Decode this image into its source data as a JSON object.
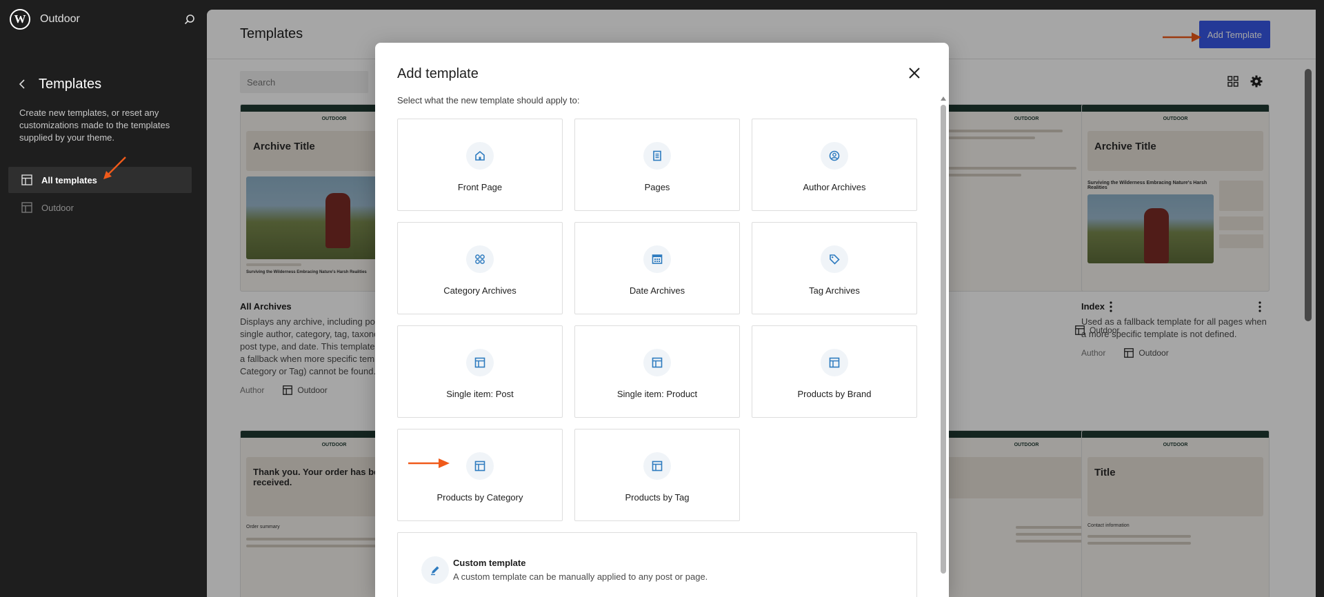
{
  "site": {
    "name": "Outdoor"
  },
  "sidebar": {
    "title": "Templates",
    "description": "Create new templates, or reset any customizations made to the templates supplied by your theme.",
    "items": [
      {
        "label": "All templates",
        "active": true
      },
      {
        "label": "Outdoor",
        "active": false
      }
    ]
  },
  "main": {
    "title": "Templates",
    "add_button": "Add Template",
    "search_placeholder": "Search",
    "cards": [
      {
        "title": "All Archives",
        "description": "Displays any archive, including posts by a single author, category, tag, taxonomy, custom post type, and date. This template will serve as a fallback when more specific templates (e.g. Category or Tag) cannot be found.",
        "author_label": "Author",
        "theme": "Outdoor",
        "thumb_heading": "Archive Title",
        "thumb_logo": "OUTDOOR",
        "thumb_caption": "Surviving the Wilderness Embracing Nature's Harsh Realities"
      },
      {
        "title": "Index",
        "description": "Used as a fallback template for all pages when a more specific template is not defined.",
        "author_label": "Author",
        "theme": "Outdoor",
        "thumb_heading": "Archive Title",
        "thumb_logo": "OUTDOOR",
        "thumb_caption": "Surviving the Wilderness Embracing Nature's Harsh Realities"
      },
      {
        "theme": "Outdoor",
        "thumb_logo": "OUTDOOR"
      },
      {
        "thumb_logo": "OUTDOOR",
        "thumb_heading": "Thank you. Your order has been received.",
        "thumb_caption": "Order summary"
      },
      {
        "thumb_logo": "OUTDOOR"
      },
      {
        "thumb_logo": "OUTDOOR",
        "thumb_heading": "Title",
        "thumb_caption": "Contact information"
      }
    ]
  },
  "modal": {
    "title": "Add template",
    "subtitle": "Select what the new template should apply to:",
    "tiles": [
      {
        "label": "Front Page",
        "icon": "home-icon"
      },
      {
        "label": "Pages",
        "icon": "page-icon"
      },
      {
        "label": "Author Archives",
        "icon": "author-icon"
      },
      {
        "label": "Category Archives",
        "icon": "category-icon"
      },
      {
        "label": "Date Archives",
        "icon": "calendar-icon"
      },
      {
        "label": "Tag Archives",
        "icon": "tag-icon"
      },
      {
        "label": "Single item: Post",
        "icon": "layout-icon"
      },
      {
        "label": "Single item: Product",
        "icon": "layout-icon"
      },
      {
        "label": "Products by Brand",
        "icon": "layout-icon"
      },
      {
        "label": "Products by Category",
        "icon": "layout-icon"
      },
      {
        "label": "Products by Tag",
        "icon": "layout-icon"
      }
    ],
    "custom": {
      "title": "Custom template",
      "description": "A custom template can be manually applied to any post or page."
    }
  },
  "colors": {
    "accent": "#3858e9",
    "icon_blue": "#2e7bbf",
    "annotation_arrow": "#f05a1a"
  }
}
